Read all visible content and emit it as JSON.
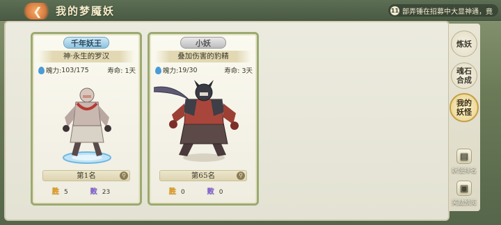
{
  "header": {
    "title": "我的梦魇妖",
    "notice_index": "11",
    "notice_text": "部弄锤在招募中大显神通，竟"
  },
  "sidebar": {
    "tabs": [
      {
        "label": "炼妖",
        "active": false
      },
      {
        "label": "魂石合成",
        "active": false
      },
      {
        "label": "我的妖怪",
        "active": true
      }
    ],
    "tools": [
      {
        "label": "妖怪排名",
        "icon": "ranking-book-icon"
      },
      {
        "label": "奖励预览",
        "icon": "reward-chest-icon"
      }
    ]
  },
  "cards": [
    {
      "rank_title": "千年妖王",
      "name": "神·永生的罗汉",
      "soul_label": "魄力:",
      "soul_value": "103/175",
      "life_label": "寿命:",
      "life_value": "1天",
      "rank_label": "第1名",
      "win_glyph": "胜",
      "wins": "5",
      "loss_glyph": "败",
      "losses": "23"
    },
    {
      "rank_title": "小妖",
      "name": "叠加伤害的豹精",
      "soul_label": "魄力:",
      "soul_value": "19/30",
      "life_label": "寿命:",
      "life_value": "3天",
      "rank_label": "第65名",
      "win_glyph": "胜",
      "wins": "0",
      "loss_glyph": "败",
      "losses": "0"
    }
  ],
  "colors": {
    "accent": "#c59f45",
    "card_border": "#9aaa72",
    "soul_drop": "#4a9cd8",
    "win": "#e6a21f",
    "loss": "#8a6ad6"
  }
}
